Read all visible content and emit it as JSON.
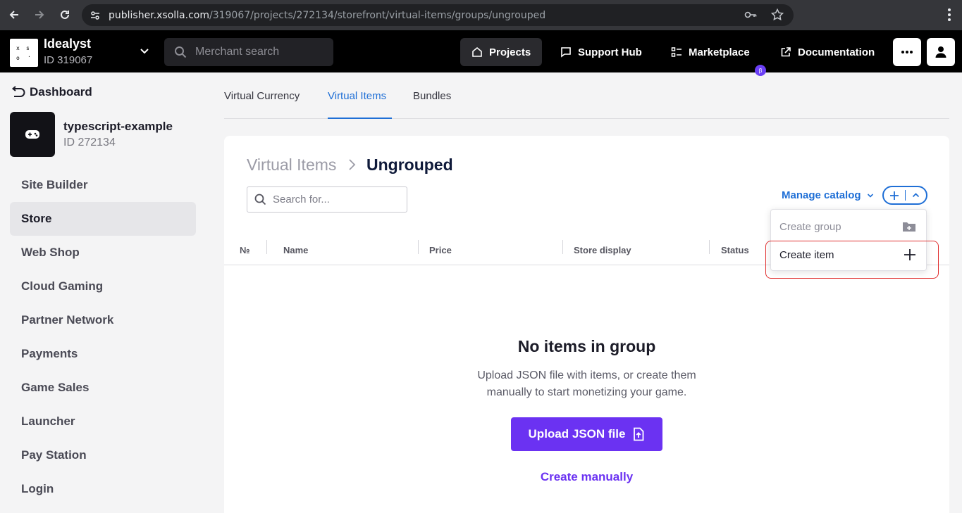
{
  "browser": {
    "url_host": "publisher.xsolla.com",
    "url_path": "/319067/projects/272134/storefront/virtual-items/groups/ungrouped"
  },
  "header": {
    "org_name": "Idealyst",
    "org_id": "ID 319067",
    "search_placeholder": "Merchant search",
    "nav": {
      "projects": "Projects",
      "support_hub": "Support Hub",
      "marketplace": "Marketplace",
      "marketplace_badge": "β",
      "documentation": "Documentation"
    }
  },
  "sidebar": {
    "dashboard": "Dashboard",
    "project_name": "typescript-example",
    "project_id": "ID 272134",
    "items": [
      {
        "label": "Site Builder"
      },
      {
        "label": "Store",
        "active": true
      },
      {
        "label": "Web Shop"
      },
      {
        "label": "Cloud Gaming"
      },
      {
        "label": "Partner Network"
      },
      {
        "label": "Payments"
      },
      {
        "label": "Game Sales"
      },
      {
        "label": "Launcher"
      },
      {
        "label": "Pay Station"
      },
      {
        "label": "Login"
      }
    ]
  },
  "tabs": [
    {
      "label": "Virtual Currency"
    },
    {
      "label": "Virtual Items",
      "active": true
    },
    {
      "label": "Bundles"
    }
  ],
  "main": {
    "breadcrumb_parent": "Virtual Items",
    "breadcrumb_current": "Ungrouped",
    "search_placeholder": "Search for...",
    "manage_catalog": "Manage catalog",
    "columns": [
      "№",
      "Name",
      "Price",
      "Store display",
      "Status"
    ],
    "empty_title": "No items in group",
    "empty_text": "Upload JSON file with items, or create them manually to start monetizing your game.",
    "upload_button": "Upload JSON file",
    "create_manually": "Create manually"
  },
  "dropdown": {
    "create_group": "Create group",
    "create_item": "Create item"
  },
  "colors": {
    "accent_blue": "#1f6fd6",
    "accent_purple": "#6b32f2",
    "highlight_red": "#e03030"
  }
}
